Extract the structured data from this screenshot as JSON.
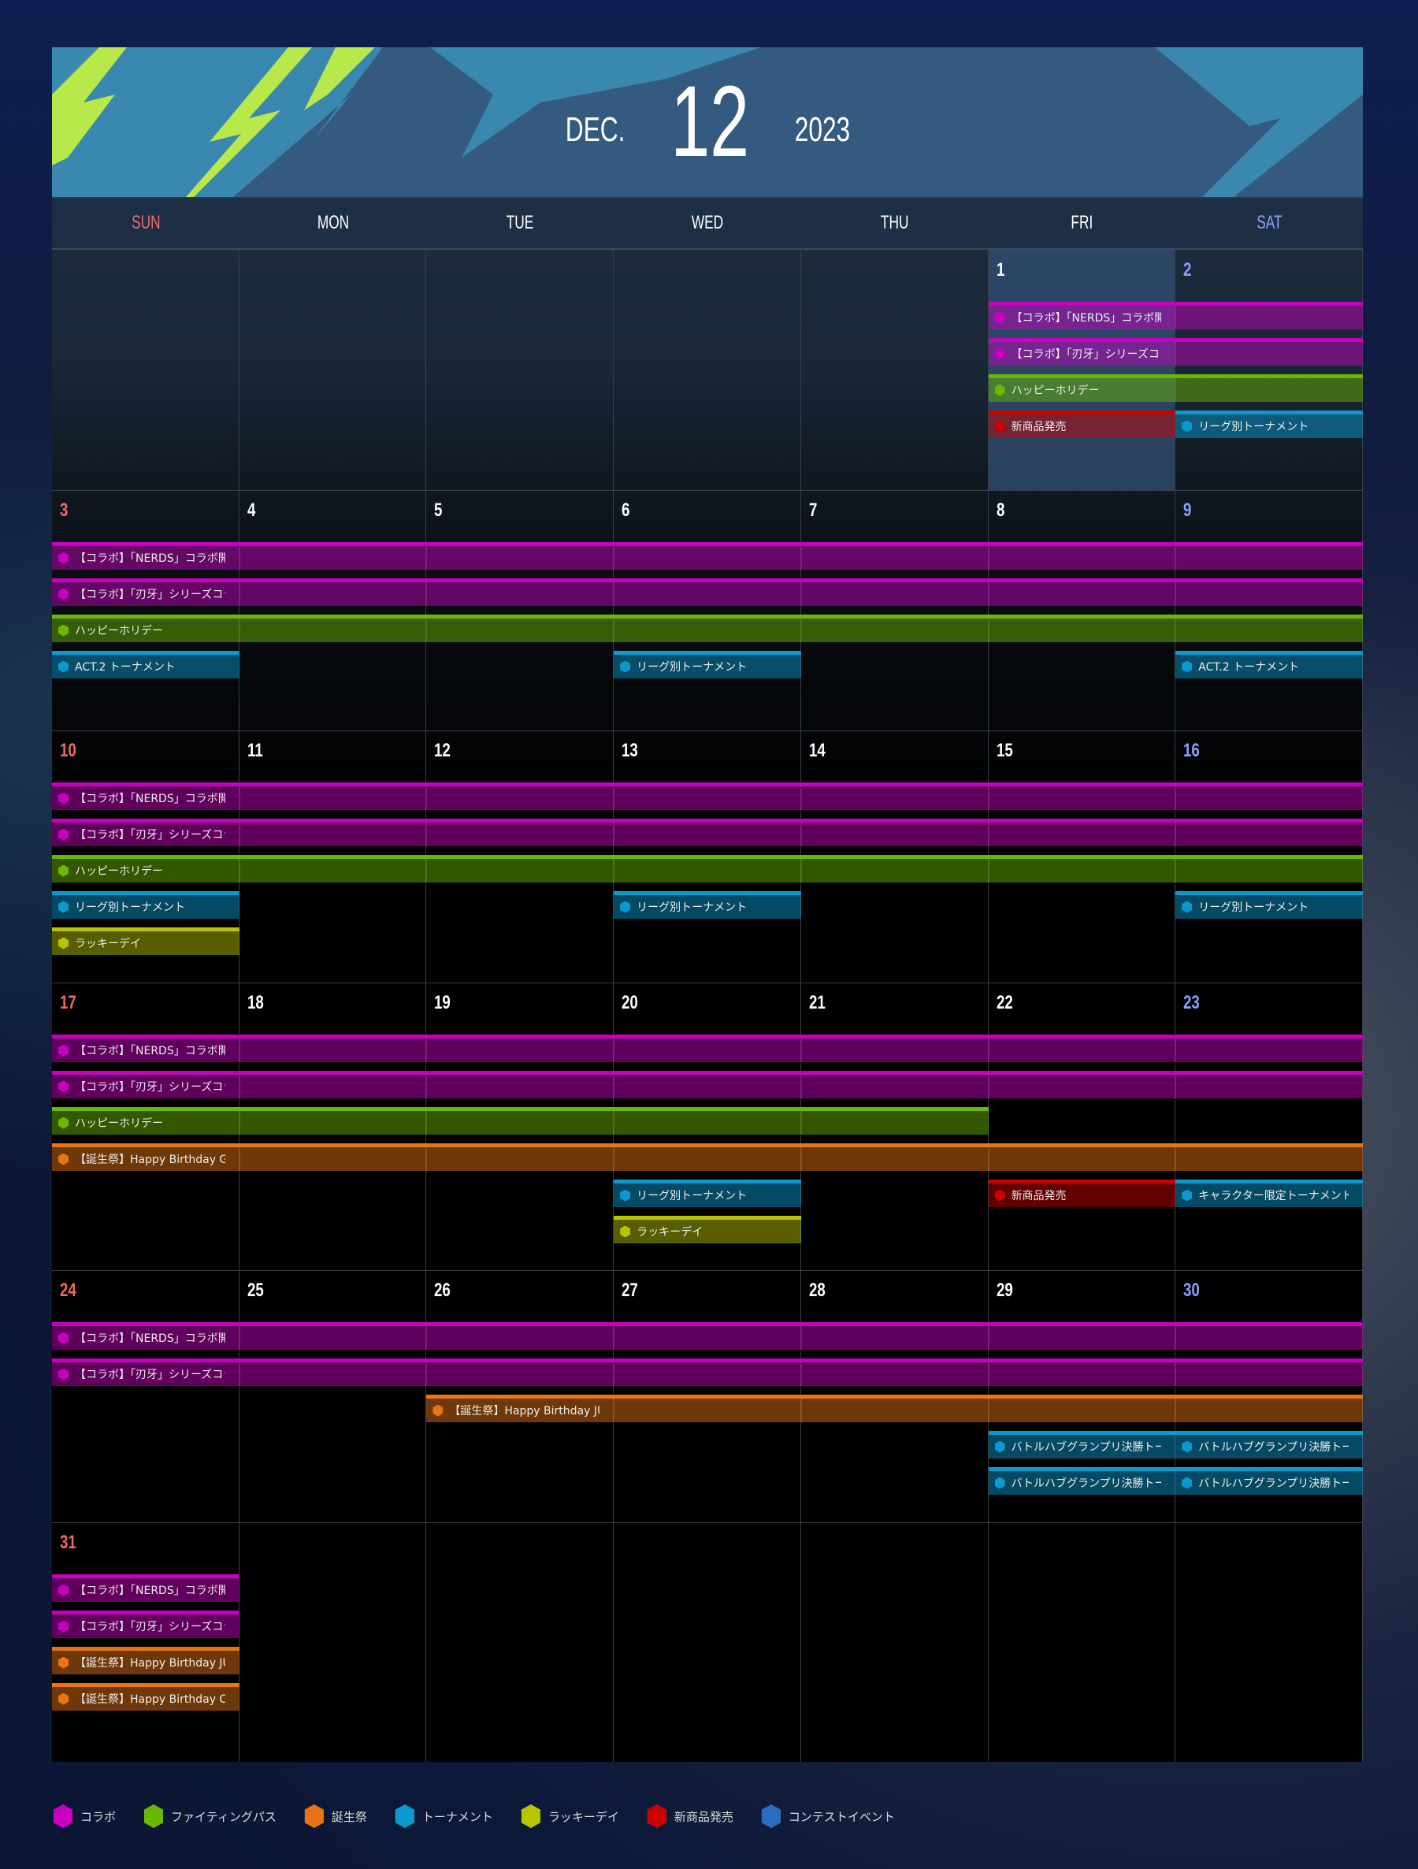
{
  "header": {
    "month": "DEC.",
    "day": "12",
    "year": "2023"
  },
  "weekdays": [
    {
      "label": "SUN",
      "color": "#f06a6a"
    },
    {
      "label": "MON",
      "color": "#ffffff"
    },
    {
      "label": "TUE",
      "color": "#ffffff"
    },
    {
      "label": "WED",
      "color": "#ffffff"
    },
    {
      "label": "THU",
      "color": "#ffffff"
    },
    {
      "label": "FRI",
      "color": "#ffffff"
    },
    {
      "label": "SAT",
      "color": "#8ea0ff"
    }
  ],
  "highlighted_day": 1,
  "categories": {
    "collab": {
      "label": "コラボ",
      "color": "#c800c0"
    },
    "fightpass": {
      "label": "ファイティングパス",
      "color": "#6cb800"
    },
    "birthday": {
      "label": "誕生祭",
      "color": "#e87512"
    },
    "tournament": {
      "label": "トーナメント",
      "color": "#0a9ad0"
    },
    "lucky": {
      "label": "ラッキーデイ",
      "color": "#b8c400"
    },
    "product": {
      "label": "新商品発売",
      "color": "#cc0000"
    },
    "contest": {
      "label": "コンテストイベント",
      "color": "#2a6cc0"
    }
  },
  "legend": [
    "collab",
    "fightpass",
    "birthday",
    "tournament",
    "lucky",
    "product",
    "contest"
  ],
  "weeks": [
    {
      "days": [
        null,
        null,
        null,
        null,
        null,
        1,
        2
      ],
      "lanes": [
        [
          {
            "cat": "collab",
            "label": "【コラボ】「NERDS」コラボ開",
            "from": 1,
            "to": 2
          }
        ],
        [
          {
            "cat": "collab",
            "label": "【コラボ】「刃牙」シリーズコラ",
            "from": 1,
            "to": 2
          }
        ],
        [
          {
            "cat": "fightpass",
            "label": "ハッピーホリデー",
            "from": 1,
            "to": 2
          }
        ],
        [
          {
            "cat": "product",
            "label": "新商品発売",
            "from": 1,
            "to": 1
          },
          {
            "cat": "tournament",
            "label": "リーグ別トーナメント",
            "from": 2,
            "to": 2
          }
        ]
      ]
    },
    {
      "days": [
        3,
        4,
        5,
        6,
        7,
        8,
        9
      ],
      "lanes": [
        [
          {
            "cat": "collab",
            "label": "【コラボ】「NERDS」コラボ開",
            "from": 3,
            "to": 9
          }
        ],
        [
          {
            "cat": "collab",
            "label": "【コラボ】「刃牙」シリーズコラ",
            "from": 3,
            "to": 9
          }
        ],
        [
          {
            "cat": "fightpass",
            "label": "ハッピーホリデー",
            "from": 3,
            "to": 9
          }
        ],
        [
          {
            "cat": "tournament",
            "label": "ACT.2 トーナメント",
            "from": 3,
            "to": 3
          },
          {
            "cat": "tournament",
            "label": "リーグ別トーナメント",
            "from": 6,
            "to": 6
          },
          {
            "cat": "tournament",
            "label": "ACT.2 トーナメント",
            "from": 9,
            "to": 9
          }
        ]
      ]
    },
    {
      "days": [
        10,
        11,
        12,
        13,
        14,
        15,
        16
      ],
      "lanes": [
        [
          {
            "cat": "collab",
            "label": "【コラボ】「NERDS」コラボ開",
            "from": 10,
            "to": 16
          }
        ],
        [
          {
            "cat": "collab",
            "label": "【コラボ】「刃牙」シリーズコラ",
            "from": 10,
            "to": 16
          }
        ],
        [
          {
            "cat": "fightpass",
            "label": "ハッピーホリデー",
            "from": 10,
            "to": 16
          }
        ],
        [
          {
            "cat": "tournament",
            "label": "リーグ別トーナメント",
            "from": 10,
            "to": 10
          },
          {
            "cat": "tournament",
            "label": "リーグ別トーナメント",
            "from": 13,
            "to": 13
          },
          {
            "cat": "tournament",
            "label": "リーグ別トーナメント",
            "from": 16,
            "to": 16
          }
        ],
        [
          {
            "cat": "lucky",
            "label": "ラッキーデイ",
            "from": 10,
            "to": 10
          }
        ]
      ]
    },
    {
      "days": [
        17,
        18,
        19,
        20,
        21,
        22,
        23
      ],
      "lanes": [
        [
          {
            "cat": "collab",
            "label": "【コラボ】「NERDS」コラボ開",
            "from": 17,
            "to": 23
          }
        ],
        [
          {
            "cat": "collab",
            "label": "【コラボ】「刃牙」シリーズコラ",
            "from": 17,
            "to": 23
          }
        ],
        [
          {
            "cat": "fightpass",
            "label": "ハッピーホリデー",
            "from": 17,
            "to": 21
          }
        ],
        [
          {
            "cat": "birthday",
            "label": "【誕生祭】Happy Birthday GUIL",
            "from": 17,
            "to": 23
          }
        ],
        [
          {
            "cat": "tournament",
            "label": "リーグ別トーナメント",
            "from": 20,
            "to": 20
          },
          {
            "cat": "product",
            "label": "新商品発売",
            "from": 22,
            "to": 22
          },
          {
            "cat": "tournament",
            "label": "キャラクター限定トーナメント",
            "from": 23,
            "to": 23
          }
        ],
        [
          {
            "cat": "lucky",
            "label": "ラッキーデイ",
            "from": 20,
            "to": 20
          }
        ]
      ]
    },
    {
      "days": [
        24,
        25,
        26,
        27,
        28,
        29,
        30
      ],
      "lanes": [
        [
          {
            "cat": "collab",
            "label": "【コラボ】「NERDS」コラボ開",
            "from": 24,
            "to": 30
          }
        ],
        [
          {
            "cat": "collab",
            "label": "【コラボ】「刃牙」シリーズコラ",
            "from": 24,
            "to": 30
          }
        ],
        [
          {
            "cat": "birthday",
            "label": "【誕生祭】Happy Birthday JURI",
            "from": 26,
            "to": 30
          }
        ],
        [
          {
            "cat": "tournament",
            "label": "バトルハブグランプリ決勝トーナ",
            "from": 29,
            "to": 29
          },
          {
            "cat": "tournament",
            "label": "バトルハブグランプリ決勝トーナ",
            "from": 30,
            "to": 30
          }
        ],
        [
          {
            "cat": "tournament",
            "label": "バトルハブグランプリ決勝トーナ",
            "from": 29,
            "to": 29
          },
          {
            "cat": "tournament",
            "label": "バトルハブグランプリ決勝トーナ",
            "from": 30,
            "to": 30
          }
        ]
      ]
    },
    {
      "days": [
        31,
        null,
        null,
        null,
        null,
        null,
        null
      ],
      "lanes": [
        [
          {
            "cat": "collab",
            "label": "【コラボ】「NERDS」コラボ開",
            "from": 31,
            "to": 31
          }
        ],
        [
          {
            "cat": "collab",
            "label": "【コラボ】「刃牙」シリーズコラ",
            "from": 31,
            "to": 31
          }
        ],
        [
          {
            "cat": "birthday",
            "label": "【誕生祭】Happy Birthday JURI",
            "from": 31,
            "to": 31
          }
        ],
        [
          {
            "cat": "birthday",
            "label": "【誕生祭】Happy Birthday CAM",
            "from": 31,
            "to": 31
          }
        ]
      ]
    }
  ]
}
